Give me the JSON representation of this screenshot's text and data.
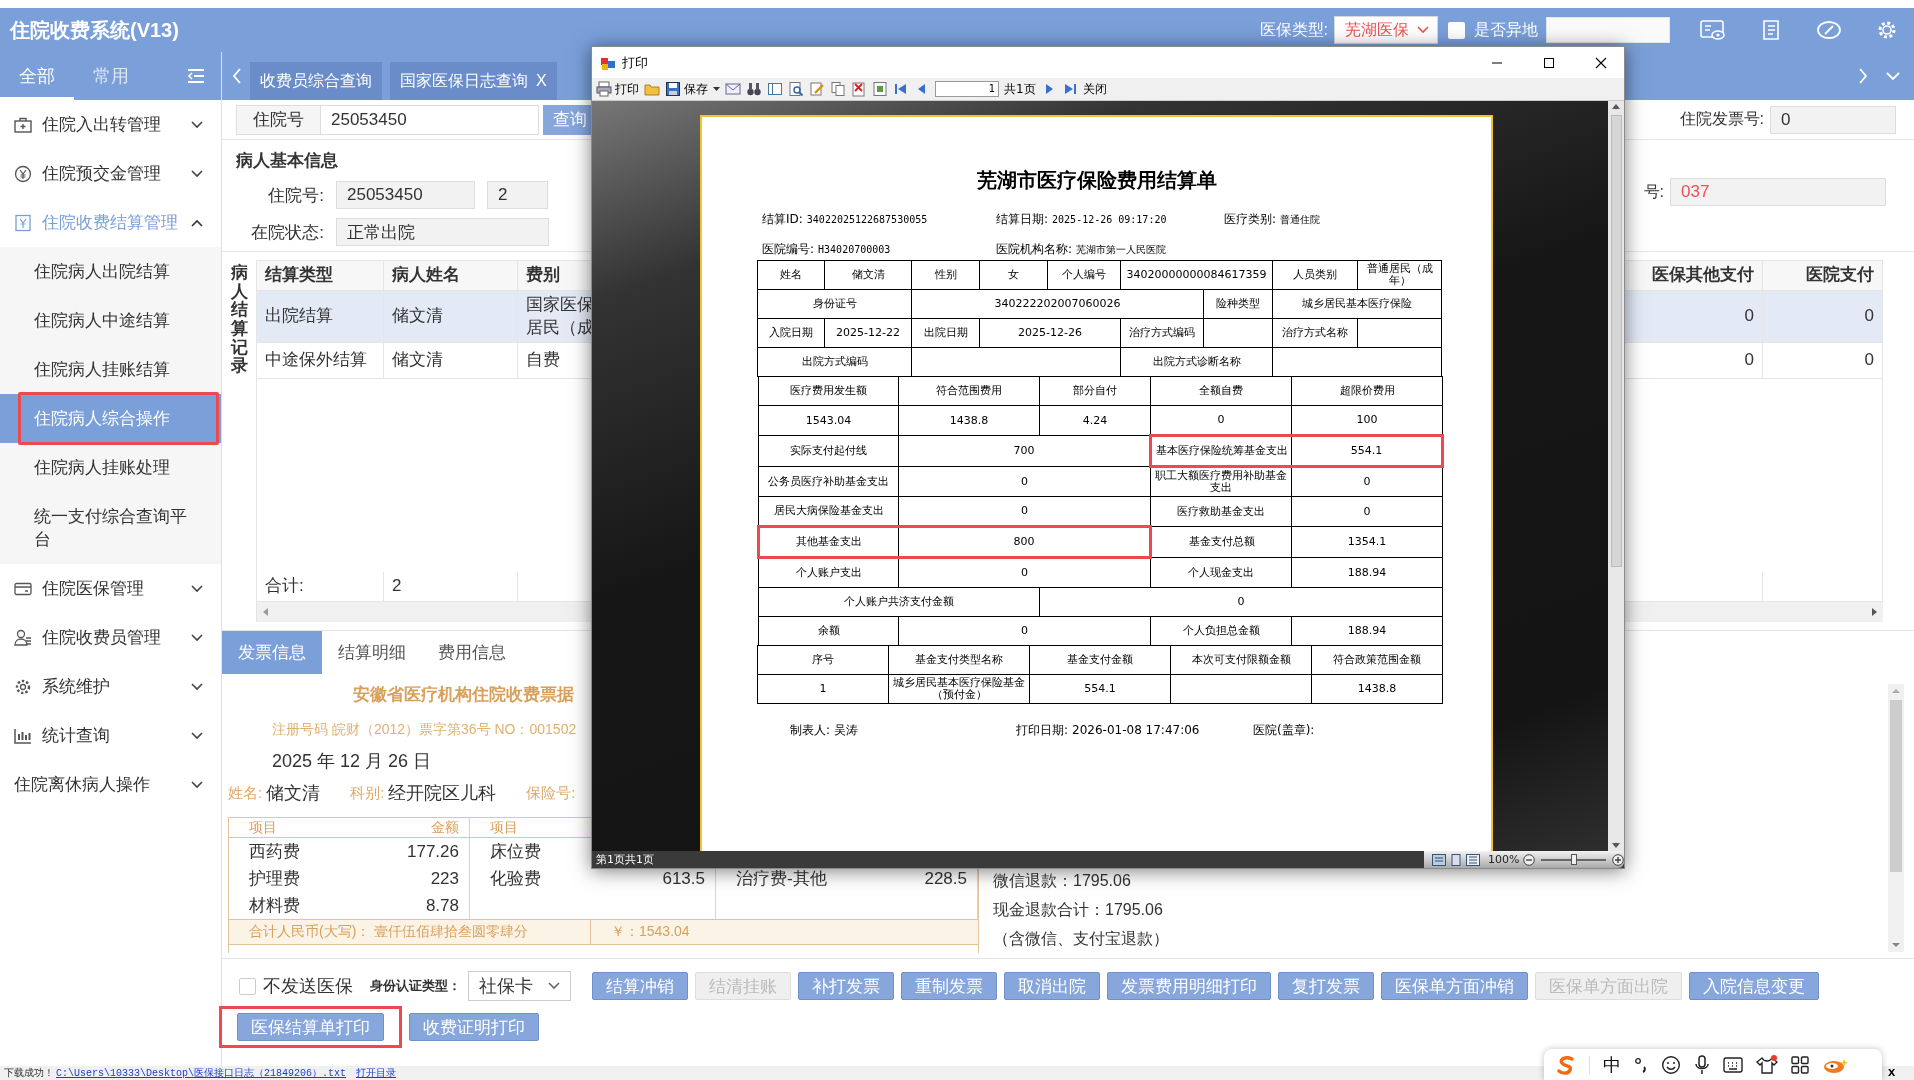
{
  "header": {
    "title": "住院收费系统(V13)",
    "insurance_label": "医保类型:",
    "insurance_value": "芜湖医保",
    "remote_label": "是否异地",
    "remote_checked": false
  },
  "sidebar": {
    "tabs": [
      {
        "label": "全部",
        "selected": true
      },
      {
        "label": "常用",
        "selected": false
      }
    ],
    "items": [
      {
        "label": "住院入出转管理",
        "expanded": false
      },
      {
        "label": "住院预交金管理",
        "expanded": false
      },
      {
        "label": "住院收费结算管理",
        "expanded": true,
        "children": [
          {
            "label": "住院病人出院结算",
            "selected": false,
            "highlighted": false
          },
          {
            "label": "住院病人中途结算",
            "selected": false,
            "highlighted": false
          },
          {
            "label": "住院病人挂账结算",
            "selected": false,
            "highlighted": false
          },
          {
            "label": "住院病人综合操作",
            "selected": true,
            "highlighted": true
          },
          {
            "label": "住院病人挂账处理",
            "selected": false,
            "highlighted": false
          },
          {
            "label": "统一支付综合查询平台",
            "selected": false,
            "highlighted": false
          }
        ]
      },
      {
        "label": "住院医保管理",
        "expanded": false
      },
      {
        "label": "住院收费员管理",
        "expanded": false
      },
      {
        "label": "系统维护",
        "expanded": false
      },
      {
        "label": "统计查询",
        "expanded": false
      },
      {
        "label": "住院离休病人操作",
        "expanded": false
      }
    ]
  },
  "tabs": [
    {
      "label": "收费员综合查询"
    },
    {
      "label": "国家医保日志查询",
      "close": "X"
    }
  ],
  "query": {
    "label": "住院号",
    "value": "25053450",
    "button": "查询",
    "invoice_label": "住院发票号:",
    "invoice_value": "0"
  },
  "patient": {
    "title": "病人基本信息",
    "rows": [
      {
        "label": "住院号:",
        "values": [
          "25053450",
          "2"
        ]
      },
      {
        "label": "在院状态:",
        "values": [
          "正常出院"
        ]
      }
    ],
    "side_label": "号:",
    "side_value": "037"
  },
  "records": {
    "title": "病人结算记录",
    "columns": [
      "结算类型",
      "病人姓名",
      "费别",
      "医保其他支付",
      "医院支付"
    ],
    "rows": [
      {
        "selected": true,
        "cells": [
          [
            "出院结算"
          ],
          [
            "储文清"
          ],
          [
            "国家医保",
            "居民（成"
          ],
          [
            "0"
          ],
          [
            "0"
          ]
        ]
      },
      {
        "selected": false,
        "cells": [
          [
            "中途保外结算"
          ],
          [
            "储文清"
          ],
          [
            "自费"
          ],
          [
            "0"
          ],
          [
            "0"
          ]
        ]
      }
    ],
    "total": [
      "合计:",
      "2"
    ]
  },
  "panel_tabs": [
    {
      "label": "发票信息",
      "selected": true
    },
    {
      "label": "结算明细",
      "selected": false
    },
    {
      "label": "费用信息",
      "selected": false
    }
  ],
  "invoice": {
    "title": "安徽省医疗机构住院收费票据",
    "register": "注册号码 皖财（2012）票字第36号 NO：001502",
    "date": "2025 年 12 月 26 日",
    "fields": [
      {
        "label": "姓名:",
        "value": "储文清"
      },
      {
        "label": "科别:",
        "value": "经开院区儿科"
      },
      {
        "label": "保险号:"
      }
    ],
    "fee_header": [
      {
        "name": "项目",
        "amount": "金额"
      },
      {
        "name": "项目"
      }
    ],
    "fee_rows": [
      [
        {
          "name": "西药费",
          "amount": "177.26"
        },
        {
          "name": "床位费"
        }
      ],
      [
        {
          "name": "护理费",
          "amount": "223"
        },
        {
          "name": "化验费",
          "amount": "613.5"
        },
        {
          "name": "治疗费-其他",
          "amount": "228.5"
        }
      ],
      [
        {
          "name": "材料费",
          "amount": "8.78"
        }
      ]
    ],
    "total": {
      "label": "合计人民币(大写)：",
      "words": "壹仟伍佰肆拾叁圆零肆分",
      "amount": "￥：1543.04"
    },
    "refunds": [
      "微信退款：1795.06",
      "现金退款合计：1795.06",
      "（含微信、支付宝退款）"
    ]
  },
  "actions": {
    "no_send_label": "不发送医保",
    "no_send_checked": false,
    "id_label": "身份认证类型：",
    "id_value": "社保卡",
    "buttons": [
      {
        "label": "结算冲销",
        "disabled": false
      },
      {
        "label": "结清挂账",
        "disabled": true
      },
      {
        "label": "补打发票",
        "disabled": false
      },
      {
        "label": "重制发票",
        "disabled": false
      },
      {
        "label": "取消出院",
        "disabled": false
      },
      {
        "label": "发票费用明细打印",
        "disabled": false
      },
      {
        "label": "复打发票",
        "disabled": false
      },
      {
        "label": "医保单方面冲销",
        "disabled": false
      },
      {
        "label": "医保单方面出院",
        "disabled": true
      },
      {
        "label": "入院信息变更",
        "disabled": false
      }
    ],
    "print_buttons": [
      {
        "label": "医保结算单打印",
        "highlighted": true
      },
      {
        "label": "收费证明打印",
        "highlighted": false
      }
    ]
  },
  "status": {
    "message": "下载成功！",
    "path": "C:\\Users\\10333\\Desktop\\医保接口日志（21849206）.txt",
    "open": "打开目录"
  },
  "print_dialog": {
    "title": "打印",
    "toolbar": {
      "print": "打印",
      "save": "保存",
      "page": "1",
      "pages": "共1页",
      "close": "关闭"
    },
    "sheet": {
      "title": "芜湖市医疗保险费用结算单",
      "info": [
        [
          {
            "label": "结算ID:",
            "value": "34022025122687530055"
          },
          {
            "label": "结算日期:",
            "value": "2025-12-26 09:17:20"
          },
          {
            "label": "医疗类别:",
            "value": "普通住院"
          }
        ],
        [
          {
            "label": "医院编号:",
            "value": "H34020700003"
          },
          {
            "label": "医院机构名称:",
            "value": "芜湖市第一人民医院"
          }
        ]
      ],
      "tables": [
        {
          "rows": [
            {
              "cells": [
                {
                  "text": "姓名"
                },
                {
                  "text": "储文清"
                },
                {
                  "text": "性别"
                },
                {
                  "text": "女"
                },
                {
                  "text": "个人编号"
                },
                {
                  "text": "34020000000084617359",
                  "colspan": 2
                },
                {
                  "text": "人员类别"
                },
                {
                  "text": "普通居民（成年）"
                }
              ]
            },
            {
              "cells": [
                {
                  "text": "身份证号",
                  "colspan": 2
                },
                {
                  "text": "340222202007060026",
                  "colspan": 4
                },
                {
                  "text": "险种类型"
                },
                {
                  "text": "城乡居民基本医疗保险",
                  "colspan": 2
                }
              ]
            },
            {
              "cells": [
                {
                  "text": "入院日期"
                },
                {
                  "text": "2025-12-22"
                },
                {
                  "text": "出院日期"
                },
                {
                  "text": "2025-12-26",
                  "colspan": 2
                },
                {
                  "text": "治疗方式编码"
                },
                {},
                {
                  "text": "治疗方式名称"
                },
                {}
              ]
            },
            {
              "cells": [
                {
                  "text": "出院方式编码",
                  "colspan": 2
                },
                {
                  "colspan": 3
                },
                {
                  "text": "出院方式诊断名称",
                  "colspan": 2
                },
                {
                  "colspan": 2
                }
              ]
            }
          ]
        },
        {
          "rows": [
            {
              "cells": [
                {
                  "text": "医疗费用发生额"
                },
                {
                  "text": "符合范围费用"
                },
                {
                  "text": "部分自付"
                },
                {
                  "text": "全额自费"
                },
                {
                  "text": "超限价费用"
                }
              ]
            },
            {
              "cells": [
                {
                  "text": "1543.04"
                },
                {
                  "text": "1438.8"
                },
                {
                  "text": "4.24"
                },
                {
                  "text": "0"
                },
                {
                  "text": "100"
                }
              ]
            },
            {
              "cells": [
                {
                  "text": "实际支付起付线"
                },
                {
                  "text": "700",
                  "colspan": 2
                },
                {
                  "text": "基本医疗保险统筹基金支出",
                  "highlighted": true
                },
                {
                  "text": "554.1",
                  "highlighted": true
                }
              ]
            },
            {
              "cells": [
                {
                  "text": "公务员医疗补助基金支出"
                },
                {
                  "text": "0",
                  "colspan": 2
                },
                {
                  "text": "职工大额医疗费用补助基金支出"
                },
                {
                  "text": "0"
                }
              ]
            },
            {
              "cells": [
                {
                  "text": "居民大病保险基金支出"
                },
                {
                  "text": "0",
                  "colspan": 2
                },
                {
                  "text": "医疗救助基金支出"
                },
                {
                  "text": "0"
                }
              ]
            },
            {
              "cells": [
                {
                  "text": "其他基金支出",
                  "highlighted": true
                },
                {
                  "text": "800",
                  "colspan": 2,
                  "highlighted": true
                },
                {
                  "text": "基金支付总额"
                },
                {
                  "text": "1354.1"
                }
              ]
            },
            {
              "cells": [
                {
                  "text": "个人账户支出"
                },
                {
                  "text": "0",
                  "colspan": 2
                },
                {
                  "text": "个人现金支出"
                },
                {
                  "text": "188.94"
                }
              ]
            },
            {
              "cells": [
                {
                  "text": "个人账户共济支付金额",
                  "colspan": 2
                },
                {
                  "text": "0",
                  "colspan": 3
                }
              ]
            },
            {
              "cells": [
                {
                  "text": "余额"
                },
                {
                  "text": "0",
                  "colspan": 2
                },
                {
                  "text": "个人负担总金额"
                },
                {
                  "text": "188.94"
                }
              ]
            }
          ]
        },
        {
          "rows": [
            {
              "cells": [
                {
                  "text": "序号"
                },
                {
                  "text": "基金支付类型名称"
                },
                {
                  "text": "基金支付金额"
                },
                {
                  "text": "本次可支付限额金额"
                },
                {
                  "text": "符合政策范围金额"
                }
              ]
            },
            {
              "cells": [
                {
                  "text": "1"
                },
                {
                  "text": "城乡居民基本医疗保险基金（预付金）"
                },
                {
                  "text": "554.1"
                },
                {},
                {
                  "text": "1438.8"
                }
              ]
            }
          ]
        }
      ],
      "footer": [
        {
          "label": "制表人:",
          "value": "吴涛"
        },
        {
          "label": "打印日期:",
          "value": "2026-01-08 17:47:06"
        },
        {
          "label": "医院(盖章):"
        }
      ]
    },
    "status": "第1页共1页",
    "zoom": "100%",
    "zoom_slider": {
      "level": 0.5
    }
  },
  "ime": {
    "mode": "中",
    "close": "x"
  }
}
